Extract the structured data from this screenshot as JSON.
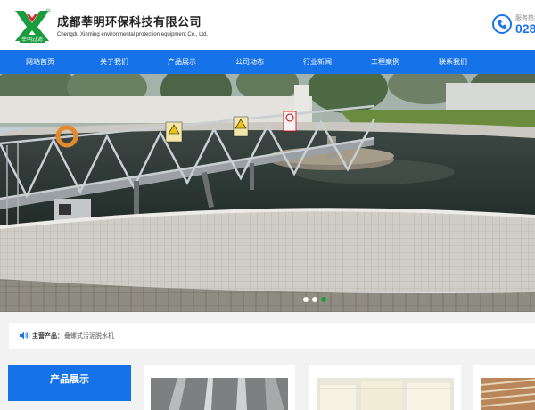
{
  "header": {
    "company_cn": "成都莘明环保科技有限公司",
    "company_en": "Chengdu Xinming environmental protection equipment Co., Ltd.",
    "logo_text": "莘明过滤",
    "hotline_label": "服务热线",
    "hotline_number": "028"
  },
  "nav": {
    "items": [
      "网站首页",
      "关于我们",
      "产品展示",
      "公司动态",
      "行业新闻",
      "工程案例",
      "联系我们"
    ]
  },
  "banner": {
    "slide_count": 3,
    "active_slide": 3
  },
  "notice": {
    "label": "主营产品：",
    "products": "叠螺式污泥脱水机"
  },
  "sidebar": {
    "title": "产品展示"
  },
  "colors": {
    "primary": "#1672e8",
    "logo_green": "#1a9c3e",
    "logo_red": "#d9262c"
  }
}
